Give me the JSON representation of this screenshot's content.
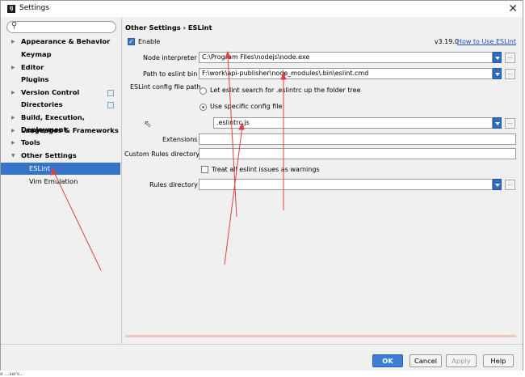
{
  "window": {
    "title": "Settings",
    "logo": "IJ",
    "close_glyph": "✕"
  },
  "sidebar": {
    "search_placeholder": "",
    "items": [
      {
        "label": "Appearance & Behavior"
      },
      {
        "label": "Keymap"
      },
      {
        "label": "Editor"
      },
      {
        "label": "Plugins"
      },
      {
        "label": "Version Control"
      },
      {
        "label": "Directories"
      },
      {
        "label": "Build, Execution, Deployment"
      },
      {
        "label": "Languages & Frameworks"
      },
      {
        "label": "Tools"
      },
      {
        "label": "Other Settings"
      },
      {
        "label": "ESLint"
      },
      {
        "label": "Vim Emulation"
      }
    ]
  },
  "content": {
    "breadcrumb": "Other Settings › ESLint",
    "enable_label": "Enable",
    "enable_checked": true,
    "version": "v3.19.0",
    "help_link": "How to Use ESLint",
    "node_interpreter": {
      "label": "Node interpreter",
      "value": "C:\\Program Files\\nodejs\\node.exe"
    },
    "eslint_bin": {
      "label": "Path to eslint bin",
      "value": "F:\\work\\api-publisher\\node_modules\\.bin\\eslint.cmd"
    },
    "config_file": {
      "label": "ESLint config file path",
      "option_search": "Let eslint search for .eslintrc up the folder tree",
      "option_specific": "Use specific config file",
      "selected": "specific",
      "value": ".eslintrc.js"
    },
    "extensions": {
      "label": "Extensions",
      "value": ""
    },
    "custom_rules": {
      "label": "Custom Rules directory",
      "value": ""
    },
    "treat_warnings": {
      "label": "Treat all eslint issues as warnings",
      "checked": false
    },
    "rules_directory": {
      "label": "Rules directory",
      "value": ""
    },
    "browse_glyph": "..."
  },
  "footer": {
    "ok": "OK",
    "cancel": "Cancel",
    "apply": "Apply",
    "help": "Help"
  },
  "bottom_fragment": "e ...serv...",
  "colors": {
    "accent": "#3574c8",
    "annotation": "#e04040"
  }
}
